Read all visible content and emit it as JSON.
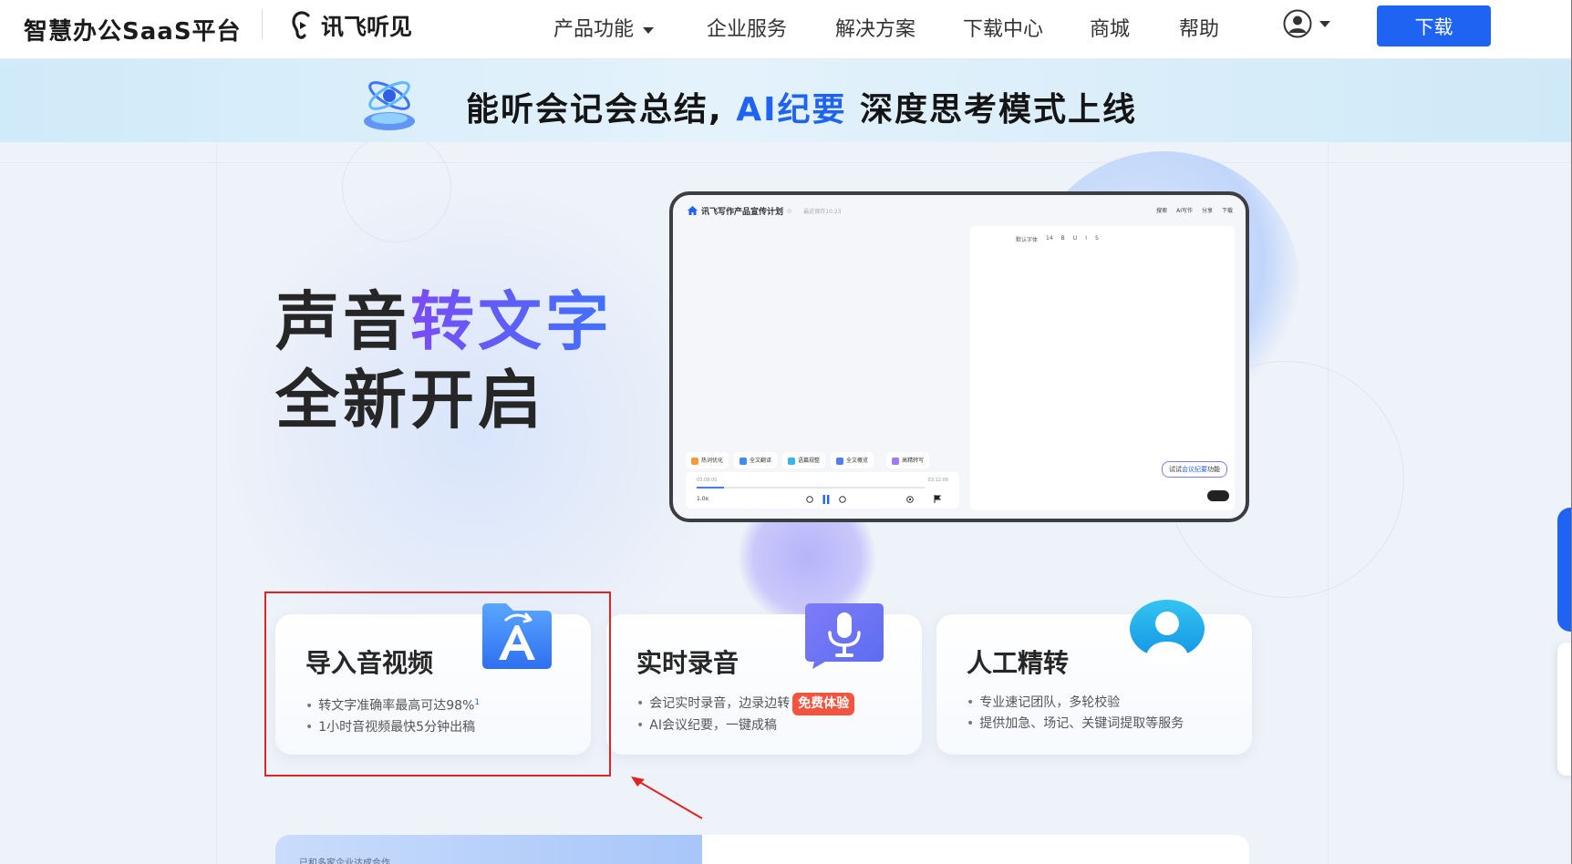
{
  "header": {
    "platform_name": "智慧办公SaaS平台",
    "logo_text": "讯飞听见",
    "nav": [
      {
        "label": "产品功能",
        "has_caret": true
      },
      {
        "label": "企业服务"
      },
      {
        "label": "解决方案"
      },
      {
        "label": "下载中心"
      },
      {
        "label": "商城"
      },
      {
        "label": "帮助"
      }
    ],
    "download_label": "下载"
  },
  "banner": {
    "text_before": "能听会记会总结, ",
    "text_highlight": "AI纪要",
    "text_after": " 深度思考模式上线"
  },
  "hero": {
    "line1_plain": "声音",
    "line1_gradient": "转文字",
    "line2": "全新开启"
  },
  "mockup": {
    "doc_title": "讯飞写作产品宣传计划",
    "saved_text": "最近保存10:23",
    "actions": [
      "搜索",
      "AI写作",
      "分享",
      "下载"
    ],
    "toolbar": [
      "默认字体",
      "14",
      "B",
      "U",
      "I",
      "S"
    ],
    "chips": [
      {
        "label": "热词优化",
        "color": "#f59a3c"
      },
      {
        "label": "全文翻译",
        "color": "#3d8cf5"
      },
      {
        "label": "语篇规整",
        "color": "#38b4e8"
      },
      {
        "label": "全文概览",
        "color": "#4f7cf7"
      },
      {
        "label": "高精转写",
        "color": "#9f7bf2"
      }
    ],
    "time_start": "03:08:00",
    "time_end": "03:12:00",
    "speed": "1.0x",
    "progress": 0.12,
    "try_prefix": "试试",
    "try_link": "会议纪要",
    "try_suffix": "功能"
  },
  "cards": [
    {
      "title": "导入音视频",
      "items": [
        "转文字准确率最高可达98%",
        "1小时音视频最快5分钟出稿"
      ],
      "footnote": "1",
      "icon": "folder-translate-icon"
    },
    {
      "title": "实时录音",
      "items": [
        "会记实时录音，边录边转",
        "AI会议纪要，一键成稿"
      ],
      "badge": "免费体验",
      "icon": "microphone-icon"
    },
    {
      "title": "人工精转",
      "items": [
        "专业速记团队，多轮校验",
        "提供加急、场记、关键词提取等服务"
      ],
      "icon": "person-icon"
    }
  ],
  "bottom": {
    "label": "已和多家企业达成合作"
  },
  "colors": {
    "accent": "#1f63f2",
    "annotation": "#e02424",
    "badge": "#f3543f"
  }
}
